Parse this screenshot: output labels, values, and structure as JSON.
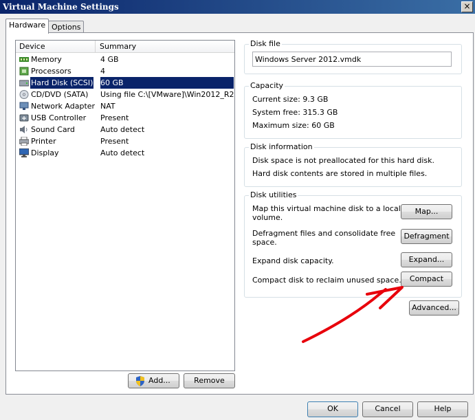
{
  "window": {
    "title": "Virtual Machine Settings",
    "close_glyph": "×"
  },
  "tabs": [
    {
      "label": "Hardware"
    },
    {
      "label": "Options"
    }
  ],
  "device_list": {
    "col_device": "Device",
    "col_summary": "Summary",
    "rows": [
      {
        "name": "Memory",
        "summary": "4 GB",
        "icon": "memory-icon"
      },
      {
        "name": "Processors",
        "summary": "4",
        "icon": "processor-icon"
      },
      {
        "name": "Hard Disk (SCSI)",
        "summary": "60 GB",
        "icon": "hard-disk-icon",
        "selected": true
      },
      {
        "name": "CD/DVD (SATA)",
        "summary": "Using file C:\\[VMware]\\Win2012_R2....",
        "icon": "cd-dvd-icon"
      },
      {
        "name": "Network Adapter",
        "summary": "NAT",
        "icon": "network-adapter-icon"
      },
      {
        "name": "USB Controller",
        "summary": "Present",
        "icon": "usb-icon"
      },
      {
        "name": "Sound Card",
        "summary": "Auto detect",
        "icon": "sound-card-icon"
      },
      {
        "name": "Printer",
        "summary": "Present",
        "icon": "printer-icon"
      },
      {
        "name": "Display",
        "summary": "Auto detect",
        "icon": "display-icon"
      }
    ],
    "add_label": "Add...",
    "remove_label": "Remove"
  },
  "disk_file": {
    "title": "Disk file",
    "value": "Windows Server 2012.vmdk"
  },
  "capacity": {
    "title": "Capacity",
    "current": "Current size:  9.3 GB",
    "free": "System free:  315.3 GB",
    "max": "Maximum size:  60 GB"
  },
  "disk_info": {
    "title": "Disk information",
    "line1": "Disk space is not preallocated for this hard disk.",
    "line2": "Hard disk contents are stored in multiple files."
  },
  "disk_utilities": {
    "title": "Disk utilities",
    "map_desc_1": "Map this virtual machine disk to a local",
    "map_desc_2": "volume.",
    "map_btn": "Map...",
    "defrag_desc_1": "Defragment files and consolidate free",
    "defrag_desc_2": "space.",
    "defrag_btn": "Defragment",
    "expand_desc": "Expand disk capacity.",
    "expand_btn": "Expand...",
    "compact_desc": "Compact disk to reclaim unused space.",
    "compact_btn": "Compact"
  },
  "advanced_btn": "Advanced...",
  "footer": {
    "ok": "OK",
    "cancel": "Cancel",
    "help": "Help"
  },
  "colors": {
    "annotation_arrow": "#e8000b",
    "selection": "#0a246a"
  }
}
